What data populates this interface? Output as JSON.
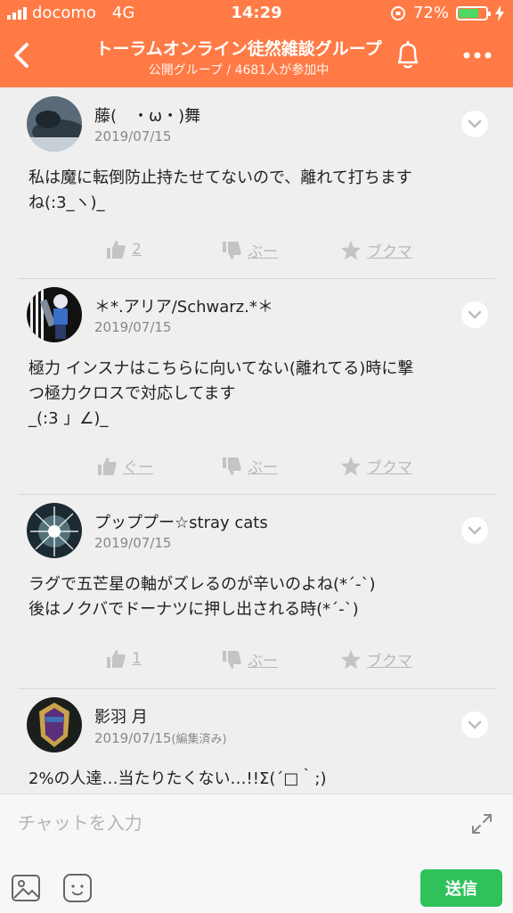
{
  "status": {
    "carrier": "docomo",
    "network": "4G",
    "time": "14:29",
    "battery": "72%",
    "battery_level": 0.72
  },
  "header": {
    "title": "トーラムオンライン徒然雑談グループ",
    "subtitle": "公開グループ / 4681人が参加中"
  },
  "posts": [
    {
      "username": "藤(　・ω・)舞",
      "date": "2019/07/15",
      "body": "私は魔に転倒防止持たせてないので、離れて打ちます\nね(:3_ヽ)_",
      "like": "2",
      "dislike": "ぶー",
      "bookmark": "ブクマ"
    },
    {
      "username": "＊*.アリア/Schwarz.*＊",
      "date": "2019/07/15",
      "body": "極力 インスナはこちらに向いてない(離れてる)時に撃\nつ極力クロスで対応してます\n_(:3 」∠)_",
      "like": "ぐー",
      "dislike": "ぶー",
      "bookmark": "ブクマ"
    },
    {
      "username": "プッププー☆stray cats",
      "date": "2019/07/15",
      "body": "ラグで五芒星の軸がズレるのが辛いのよね(*´-`)\n後はノクバでドーナツに押し出される時(*´-`)",
      "like": "1",
      "dislike": "ぶー",
      "bookmark": "ブクマ"
    },
    {
      "username": "影羽 月",
      "date": "2019/07/15",
      "edited": "(編集済み)",
      "body": "2%の人達…当たりたくない…!!Σ(´□｀;)"
    }
  ],
  "composer": {
    "placeholder": "チャットを入力",
    "send_label": "送信"
  },
  "colors": {
    "header": "#ff7a45",
    "send": "#2fc25b"
  }
}
